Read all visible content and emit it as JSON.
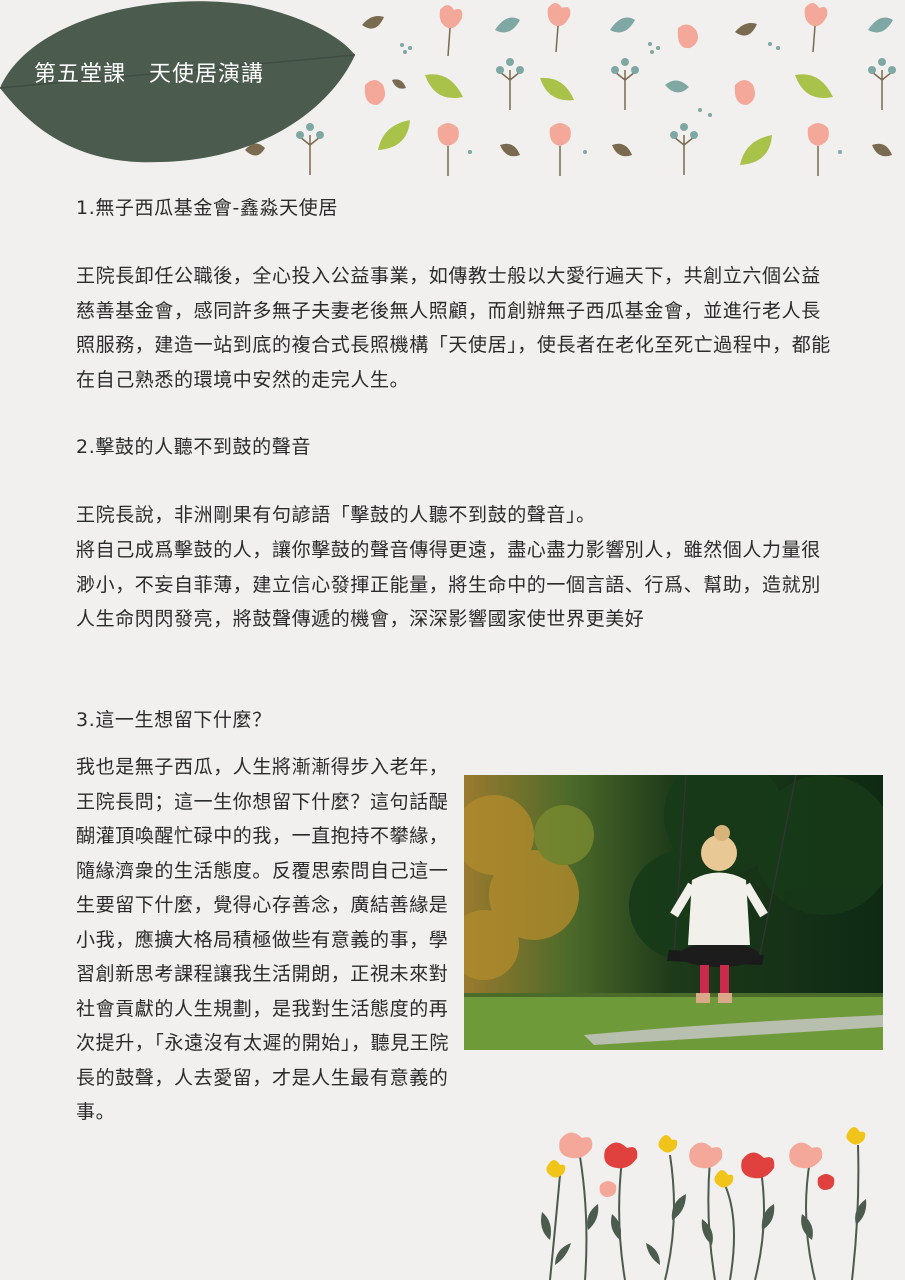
{
  "header": {
    "title": "第五堂課　天使居演講"
  },
  "sections": [
    {
      "heading": "1.無子西瓜基金會-鑫淼天使居",
      "paragraphs": [
        "王院長卸任公職後，全心投入公益事業，如傳教士般以大愛行遍天下，共創立六個公益慈善基金會，感同許多無子夫妻老後無人照顧，而創辦無子西瓜基金會，並進行老人長照服務，建造一站到底的複合式長照機構「天使居」，使長者在老化至死亡過程中，都能在自己熟悉的環境中安然的走完人生。"
      ]
    },
    {
      "heading": "2.擊鼓的人聽不到鼓的聲音",
      "paragraphs": [
        "王院長說，非洲剛果有句諺語「擊鼓的人聽不到鼓的聲音」。",
        "將自己成爲擊鼓的人，讓你擊鼓的聲音傳得更遠，盡心盡力影響別人，雖然個人力量很渺小，不妄自菲薄，建立信心發揮正能量，將生命中的一個言語、行爲、幫助，造就別人生命閃閃發亮，將鼓聲傳遞的機會，深深影響國家使世界更美好"
      ]
    },
    {
      "heading": "3.這一生想留下什麼？",
      "paragraphs": [
        "我也是無子西瓜，人生將漸漸得步入老年，王院長問；這一生你想留下什麼？這句話醍醐灌頂喚醒忙碌中的我，一直抱持不攀緣，隨緣濟衆的生活態度。反覆思索問自己這一生要留下什麼，覺得心存善念，廣結善緣是小我，應擴大格局積極做些有意義的事，學習創新思考課程讓我生活開朗，正視未來對社會貢獻的人生規劃，是我對生活態度的再次提升，「永遠沒有太遲的開始」，聽見王院長的鼓聲，人去愛留，才是人生最有意義的事。"
      ]
    }
  ],
  "colors": {
    "background": "#f1f0ee",
    "banner_leaf": "#4b5b4e",
    "pink": "#f4a89a",
    "teal": "#7fa8a4",
    "lime": "#a9c24a",
    "brown": "#7a6a4f",
    "red": "#e0413f",
    "yellow": "#f0c419"
  }
}
